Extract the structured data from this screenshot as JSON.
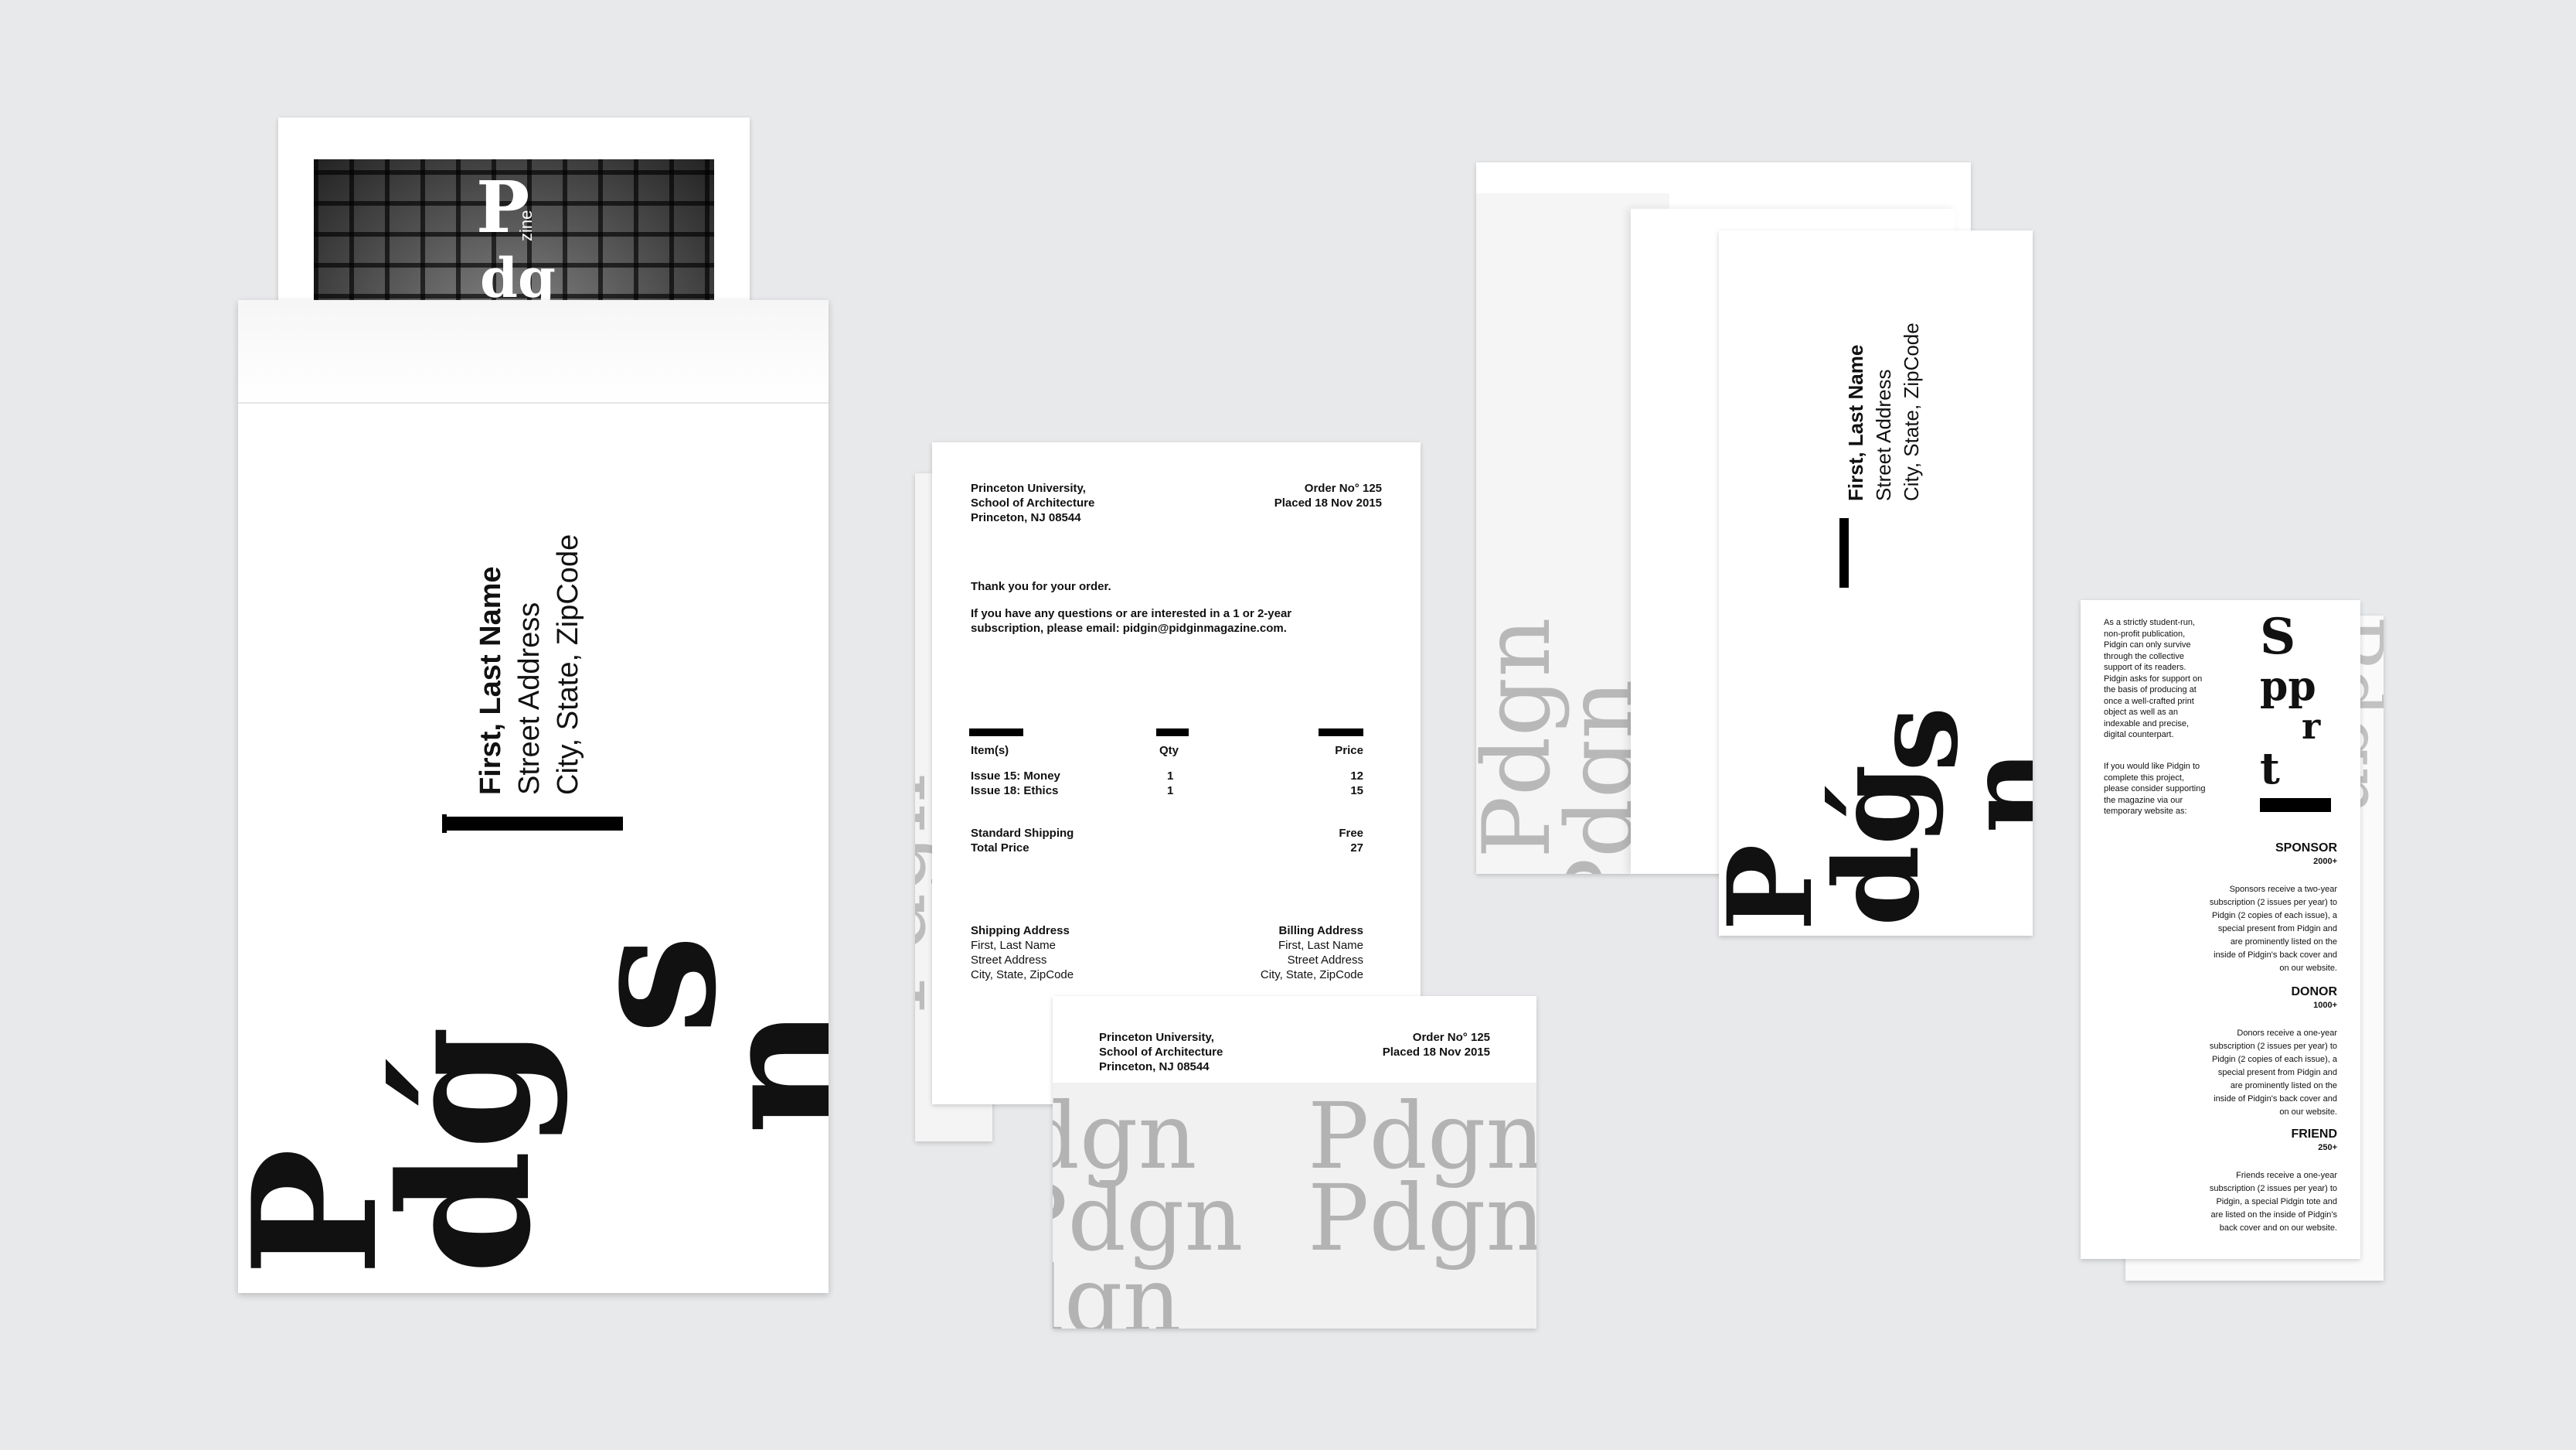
{
  "envelope": {
    "name": "First, Last Name",
    "street": "Street Address",
    "city": "City, State, ZipCode"
  },
  "magazine": {
    "letter": "P",
    "side": "zine",
    "small": "dg"
  },
  "brand": {
    "letters": [
      "P",
      "dǵ",
      "s",
      "n"
    ],
    "pattern": "Pdgn"
  },
  "invoice": {
    "from": [
      "Princeton University,",
      "School of Architecture",
      "Princeton, NJ 08544"
    ],
    "order": [
      "Order No° 125",
      "Placed 18 Nov 2015"
    ],
    "thanks": "Thank you for your order.",
    "questions": [
      "If you have any questions or are interested in a 1 or 2-year",
      "subscription, please email: pidgin@pidginmagazine.com."
    ],
    "headers": {
      "item": "Item(s)",
      "qty": "Qty",
      "price": "Price"
    },
    "rows": [
      {
        "item": "Issue 15: Money",
        "qty": "1",
        "price": "12"
      },
      {
        "item": "Issue 18: Ethics",
        "qty": "1",
        "price": "15"
      }
    ],
    "shipping_label": "Standard Shipping",
    "shipping_value": "Free",
    "total_label": "Total Price",
    "total_value": "27",
    "ship_addr": [
      "Shipping Address",
      "First, Last Name",
      "Street Address",
      "City, State, ZipCode"
    ],
    "bill_addr": [
      "Billing Address",
      "First, Last Name",
      "Street Address",
      "City, State, ZipCode"
    ]
  },
  "support": {
    "intro": [
      "As a strictly student-run,",
      "non-profit publication,",
      "Pidgin can only survive",
      "through the collective",
      "support of its readers.",
      "Pidgin asks for support on",
      "the basis of producing at",
      "once a well-crafted print",
      "object as well as an",
      "indexable and precise,",
      "digital counterpart."
    ],
    "intro2": [
      "If you would like Pidgin to",
      "complete this project,",
      "please consider supporting",
      "the magazine via our",
      "temporary website as:"
    ],
    "title_letters": [
      "S",
      "pp",
      "r",
      "t"
    ],
    "tiers": [
      {
        "name": "SPONSOR",
        "amount": "2000+",
        "desc": [
          "Sponsors receive a two-year",
          "subscription (2 issues per year) to",
          "Pidgin (2 copies of each issue), a",
          "special present from Pidgin and",
          "are prominently listed on the",
          "inside of Pidgin's back cover and",
          "on our website."
        ]
      },
      {
        "name": "DONOR",
        "amount": "1000+",
        "desc": [
          "Donors receive a one-year",
          "subscription (2 issues per year) to",
          "Pidgin (2 copies of each issue), a",
          "special present from Pidgin and",
          "are prominently listed on the",
          "inside of Pidgin's back cover and",
          "on our website."
        ]
      },
      {
        "name": "FRIEND",
        "amount": "250+",
        "desc": [
          "Friends receive a one-year",
          "subscription (2 issues per year) to",
          "Pidgin, a special Pidgin tote and",
          "are listed on the inside of Pidgin's",
          "back cover and on our website."
        ]
      }
    ]
  }
}
